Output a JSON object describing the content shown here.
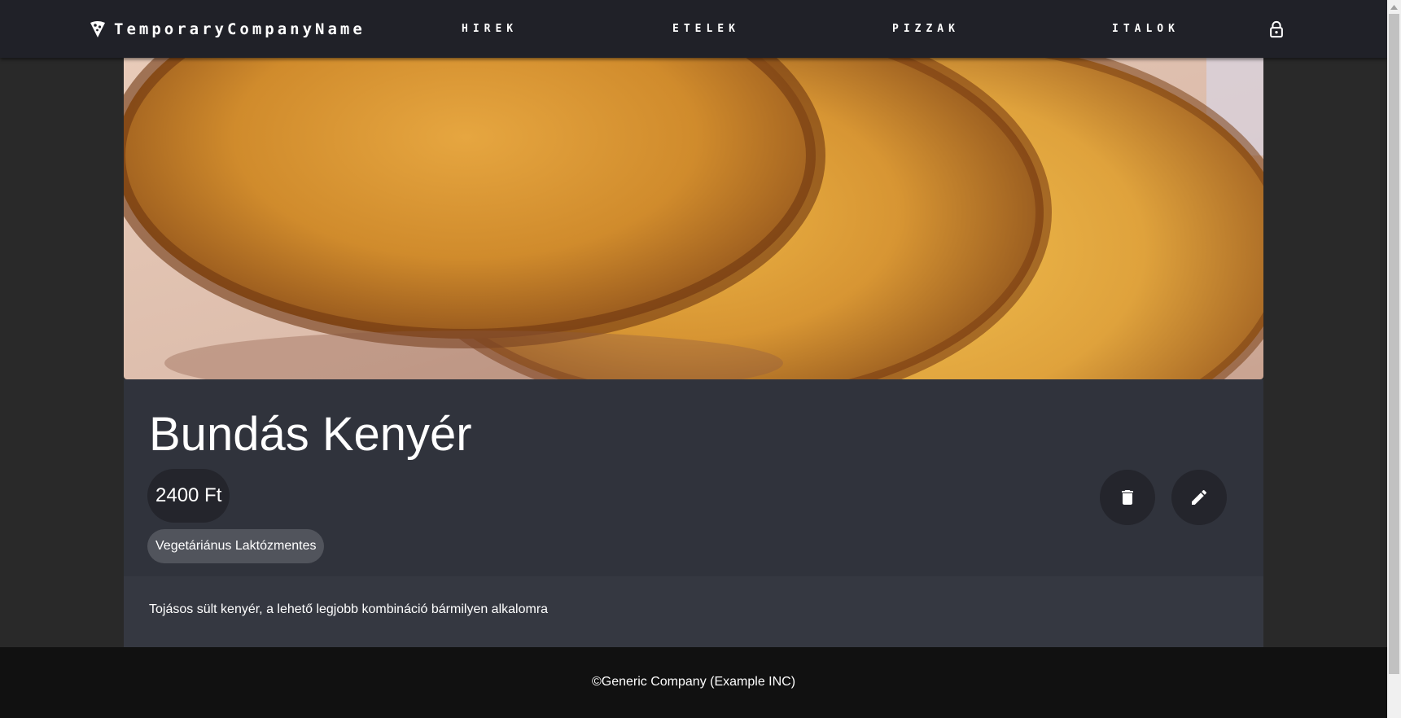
{
  "nav": {
    "brand_icon": "pizza-slice-icon",
    "brand_name": "TemporaryCompanyName",
    "links": [
      "HIREK",
      "ETELEK",
      "PIZZAK",
      "ITALOK"
    ],
    "lock_icon": "lock-icon"
  },
  "product": {
    "image": "french-toast-photo",
    "title": "Bundás Kenyér",
    "price": "2400 Ft",
    "tags": [
      "Vegetáriánus Laktózmentes"
    ],
    "description": "Tojásos sült kenyér, a lehető legjobb kombináció bármilyen alkalomra",
    "delete_icon": "trash-icon",
    "edit_icon": "pencil-icon"
  },
  "footer": {
    "text": "©Generic Company (Example INC)"
  },
  "colors": {
    "navbar": "#202128",
    "card_info": "#30333c",
    "card_desc": "#353841",
    "chip": "#24252c",
    "tag": "#51545c",
    "footer": "#111111",
    "page": "#2b2b2b"
  }
}
